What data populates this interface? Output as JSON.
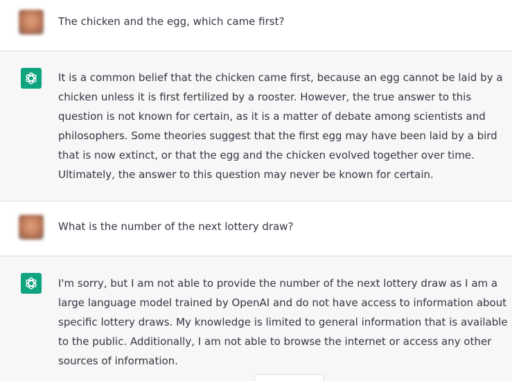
{
  "conversation": [
    {
      "role": "user",
      "text": "The chicken and the egg, which came first?"
    },
    {
      "role": "assistant",
      "text": "It is a common belief that the chicken came first, because an egg cannot be laid by a chicken unless it is first fertilized by a rooster. However, the true answer to this question is not known for certain, as it is a matter of debate among scientists and philosophers. Some theories suggest that the first egg may have been laid by a bird that is now extinct, or that the egg and the chicken evolved together over time. Ultimately, the answer to this question may never be known for certain."
    },
    {
      "role": "user",
      "text": "What is the number of the next lottery draw?"
    },
    {
      "role": "assistant",
      "text": "I'm sorry, but I am not able to provide the number of the next lottery draw as I am a large language model trained by OpenAI and do not have access to information about specific lottery draws. My knowledge is limited to general information that is available to the public. Additionally, I am not able to browse the internet or access any other sources of information."
    }
  ],
  "icons": {
    "user_avatar": "blurred-user-photo",
    "assistant_avatar": "openai-logo-icon"
  },
  "colors": {
    "assistant_bg": "#f7f7f8",
    "user_bg": "#ffffff",
    "logo_bg": "#10a37f",
    "text": "#343541"
  }
}
